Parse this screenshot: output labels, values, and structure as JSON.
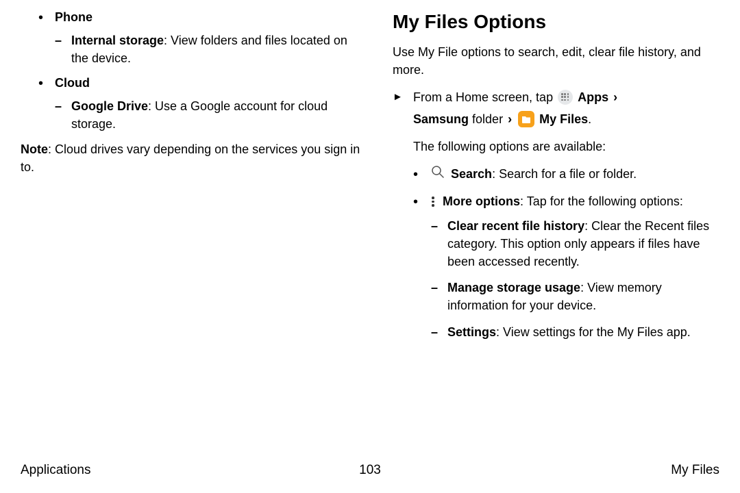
{
  "left": {
    "phone_label": "Phone",
    "internal_storage_label": "Internal storage",
    "internal_storage_desc": ": View folders and files located on the device.",
    "cloud_label": "Cloud",
    "google_drive_label": "Google Drive",
    "google_drive_desc": ": Use a Google account for cloud storage.",
    "note_label": "Note",
    "note_desc": ": Cloud drives vary depending on the services you sign in to."
  },
  "right": {
    "title": "My Files Options",
    "intro": "Use My File options to search, edit, clear file history, and more.",
    "step_prefix": "From a Home screen, tap ",
    "apps_label": "Apps",
    "samsung_label": "Samsung",
    "folder_word": " folder ",
    "myfiles_label": "My Files",
    "period": ".",
    "options_intro": "The following options are available:",
    "search_label": "Search",
    "search_desc": ": Search for a file or folder.",
    "more_label": "More options",
    "more_desc": ": Tap for the following options:",
    "clear_label": "Clear recent file history",
    "clear_desc": ": Clear the Recent files category. This option only appears if files have been accessed recently.",
    "manage_label": "Manage storage usage",
    "manage_desc": ": View memory information for your device.",
    "settings_label": "Settings",
    "settings_desc": ": View settings for the My Files app."
  },
  "footer": {
    "left": "Applications",
    "center": "103",
    "right": "My Files"
  }
}
